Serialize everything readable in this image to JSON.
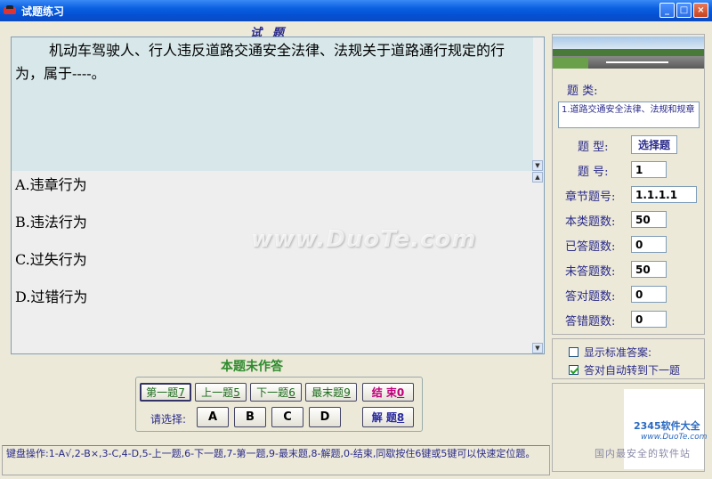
{
  "window": {
    "title": "试题练习",
    "minimize": "_",
    "maximize": "□",
    "close": "×"
  },
  "question": {
    "header": "试题",
    "text": "机动车驾驶人、行人违反道路交通安全法律、法规关于道路通行规定的行为，属于----。",
    "options": [
      "A.违章行为",
      "B.违法行为",
      "C.过失行为",
      "D.过错行为"
    ]
  },
  "status_message": "本题未作答",
  "nav": {
    "first": "第一题",
    "first_key": "7",
    "prev": "上一题",
    "prev_key": "5",
    "next": "下一题",
    "next_key": "6",
    "last": "最末题",
    "last_key": "9",
    "end": "结 束",
    "end_key": "0",
    "explain": "解 题",
    "explain_key": "8"
  },
  "choose": {
    "label": "请选择:",
    "answers": [
      "A",
      "B",
      "C",
      "D"
    ]
  },
  "statusbar": "键盘操作:1-A√,2-B×,3-C,4-D,5-上一题,6-下一题,7-第一题,9-最末题,8-解题,0-结束,同歇按住6键或5键可以快速定位题。",
  "info": {
    "category_label": "题 类:",
    "category_value": "1.道路交通安全法律、法规和规章",
    "type_label": "题 型:",
    "type_value": "选择题",
    "number_label": "题 号:",
    "number_value": "1",
    "chapter_label": "章节题号:",
    "chapter_value": "1.1.1.1",
    "total_label": "本类题数:",
    "total_value": "50",
    "answered_label": "已答题数:",
    "answered_value": "0",
    "unanswered_label": "未答题数:",
    "unanswered_value": "50",
    "correct_label": "答对题数:",
    "correct_value": "0",
    "wrong_label": "答错题数:",
    "wrong_value": "0"
  },
  "options_panel": {
    "show_answer": {
      "label": "显示标准答案:",
      "checked": false
    },
    "auto_next": {
      "label": "答对自动转到下一题",
      "checked": true
    }
  },
  "watermark": "www.DuoTe.com",
  "logo": {
    "brand": "2345软件大全",
    "url": "www.DuoTe.com",
    "slogan": "国内最安全的软件站"
  }
}
